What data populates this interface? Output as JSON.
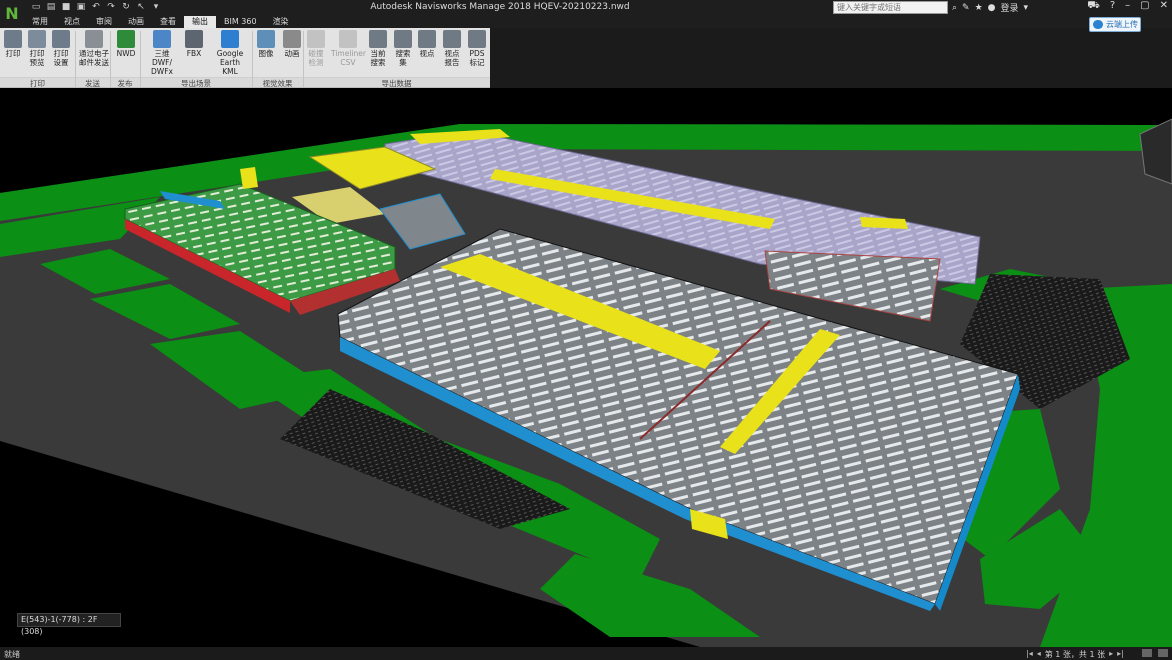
{
  "window": {
    "title": "Autodesk Navisworks Manage 2018    HQEV-20210223.nwd",
    "logo": "N",
    "search_placeholder": "键入关键字或短语",
    "user": "登录",
    "upload_button": "云端上传"
  },
  "tabs": [
    {
      "label": "常用",
      "active": false
    },
    {
      "label": "视点",
      "active": false
    },
    {
      "label": "审阅",
      "active": false
    },
    {
      "label": "动画",
      "active": false
    },
    {
      "label": "查看",
      "active": false
    },
    {
      "label": "输出",
      "active": true
    },
    {
      "label": "BIM 360",
      "active": false
    },
    {
      "label": "渲染",
      "active": false
    }
  ],
  "ribbon": {
    "groups": [
      {
        "label": "打印",
        "items": [
          {
            "line1": "打印",
            "line2": "",
            "icon": "printer-icon",
            "enabled": true
          },
          {
            "line1": "打印",
            "line2": "预览",
            "icon": "print-preview-icon",
            "enabled": true
          },
          {
            "line1": "打印",
            "line2": "设置",
            "icon": "print-setup-icon",
            "enabled": true
          }
        ]
      },
      {
        "label": "发送",
        "items": [
          {
            "line1": "通过电子",
            "line2": "邮件发送",
            "icon": "email-icon",
            "enabled": true
          }
        ]
      },
      {
        "label": "发布",
        "items": [
          {
            "line1": "NWD",
            "line2": "",
            "icon": "nwd-icon",
            "enabled": true
          }
        ]
      },
      {
        "label": "导出场景",
        "items": [
          {
            "line1": "三维 DWF/",
            "line2": "DWFx",
            "icon": "dwf-icon",
            "enabled": true
          },
          {
            "line1": "FBX",
            "line2": "",
            "icon": "fbx-icon",
            "enabled": true
          },
          {
            "line1": "Google",
            "line2": "Earth KML",
            "icon": "google-earth-icon",
            "enabled": true
          }
        ]
      },
      {
        "label": "视觉效果",
        "items": [
          {
            "line1": "图像",
            "line2": "",
            "icon": "image-icon",
            "enabled": true
          },
          {
            "line1": "动画",
            "line2": "",
            "icon": "animation-icon",
            "enabled": true
          }
        ]
      },
      {
        "label": "导出数据",
        "items": [
          {
            "line1": "碰撞",
            "line2": "检测",
            "icon": "clash-icon",
            "enabled": false
          },
          {
            "line1": "Timeliner",
            "line2": "CSV",
            "icon": "timeliner-csv-icon",
            "enabled": false
          },
          {
            "line1": "当前",
            "line2": "搜索",
            "icon": "current-search-icon",
            "enabled": true
          },
          {
            "line1": "搜索",
            "line2": "集",
            "icon": "search-set-icon",
            "enabled": true
          },
          {
            "line1": "视点",
            "line2": "",
            "icon": "viewpoint-icon",
            "enabled": true
          },
          {
            "line1": "视点",
            "line2": "报告",
            "icon": "html-report-icon",
            "enabled": true
          },
          {
            "line1": "PDS",
            "line2": "标记",
            "icon": "pds-icon",
            "enabled": true
          }
        ]
      }
    ]
  },
  "viewport": {
    "coordinate_readout": "E(543)-1(-778) : 2F (308)"
  },
  "status": {
    "text": "就绪",
    "page_info": "第 1 张，共 1 张"
  },
  "colors": {
    "grass": "#0b8f14",
    "roof_white": "#d8dde0",
    "roof_lavender": "#b7b3d6",
    "yellow": "#e9e11a",
    "blue_facade": "#1f8fd0",
    "red_facade": "#c8262b"
  }
}
